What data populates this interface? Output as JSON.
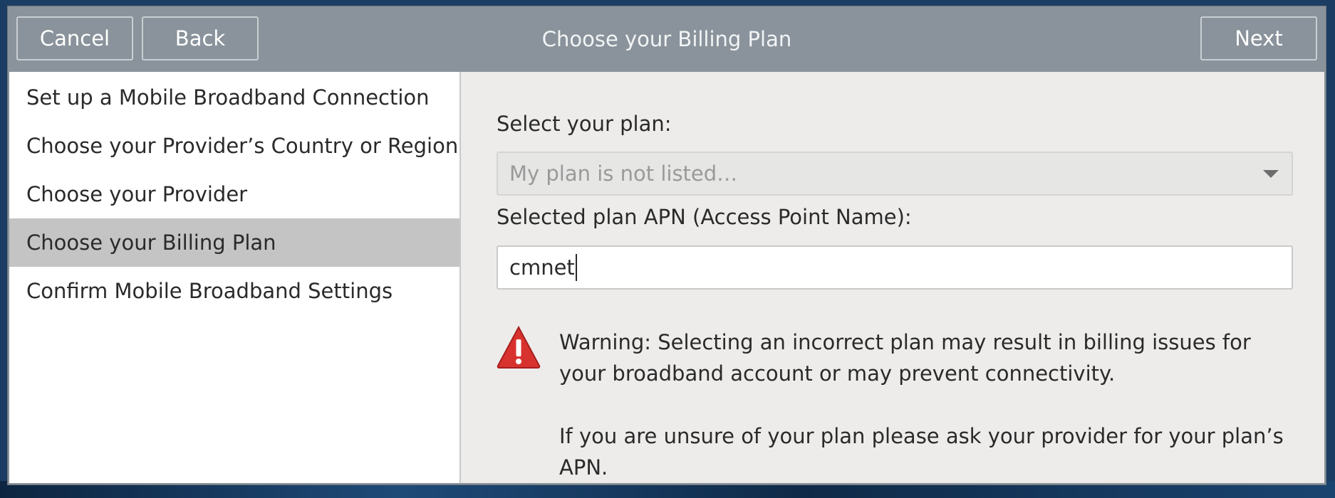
{
  "window": {
    "title": "Choose your Billing Plan"
  },
  "header": {
    "cancel_label": "Cancel",
    "back_label": "Back",
    "next_label": "Next"
  },
  "sidebar": {
    "items": [
      {
        "label": "Set up a Mobile Broadband Connection",
        "active": false
      },
      {
        "label": "Choose your Provider’s Country or Region",
        "active": false
      },
      {
        "label": "Choose your Provider",
        "active": false
      },
      {
        "label": "Choose your Billing Plan",
        "active": true
      },
      {
        "label": "Confirm Mobile Broadband Settings",
        "active": false
      }
    ]
  },
  "main": {
    "plan_label": "Select your plan:",
    "plan_select_value": "My plan is not listed…",
    "apn_label": "Selected plan APN (Access Point Name):",
    "apn_value": "cmnet",
    "warning_line1": "Warning: Selecting an incorrect plan may result in billing issues for your broadband account or may prevent connectivity.",
    "warning_line2": "If you are unsure of your plan please ask your provider for your plan’s APN."
  },
  "colors": {
    "header_bg": "#8a939b",
    "selected_item_bg": "#c4c4c4",
    "warning_red": "#d8322f"
  },
  "icons": {
    "warning": "warning-triangle-icon",
    "dropdown": "chevron-down-icon"
  }
}
